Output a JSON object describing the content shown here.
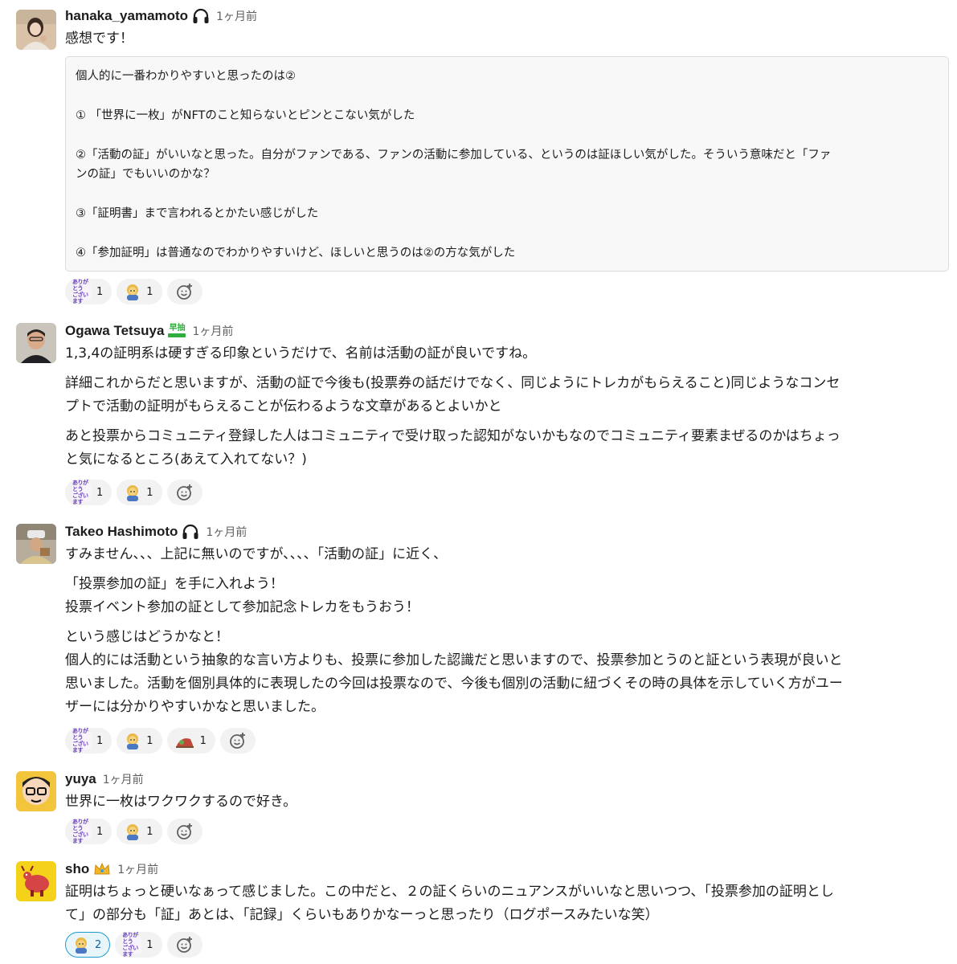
{
  "messages": [
    {
      "user": "hanaka_yamamoto",
      "status_icon": "headphones-icon",
      "time": "1ヶ月前",
      "lines": [
        "感想です！"
      ],
      "code_lines": [
        "個人的に一番わかりやすいと思ったのは②",
        "",
        "①  「世界に一枚」がNFTのこと知らないとピンとこない気がした",
        "",
        "②「活動の証」がいいなと思った。自分がファンである、ファンの活動に参加している、というのは証ほしい気がした。そういう意味だと「ファ",
        "ンの証」でもいいのかな？",
        "",
        "③「証明書」まで言われるとかたい感じがした",
        "",
        "④「参加証明」は普通なのでわかりやすいけど、ほしいと思うのは②の方な気がした"
      ],
      "reactions": [
        {
          "emoji": "arigatou-gozaimasu-icon",
          "count": "1"
        },
        {
          "emoji": "person-bowing-icon",
          "count": "1"
        }
      ]
    },
    {
      "user": "Ogawa Tetsuya",
      "status_icon": "hayaben-icon",
      "status_label": "早抽",
      "time": "1ヶ月前",
      "paragraphs": [
        [
          "1,3,4の証明系は硬すぎる印象というだけで、名前は活動の証が良いですね。"
        ],
        [
          "詳細これからだと思いますが、活動の証で今後も(投票券の話だけでなく、同じようにトレカがもらえること)同じようなコンセ",
          "プトで活動の証明がもらえることが伝わるような文章があるとよいかと"
        ],
        [
          "あと投票からコミュニティ登録した人はコミュニティで受け取った認知がないかもなのでコミュニティ要素まぜるのかはちょっ",
          "と気になるところ(あえて入れてない？)"
        ]
      ],
      "reactions": [
        {
          "emoji": "arigatou-gozaimasu-icon",
          "count": "1"
        },
        {
          "emoji": "person-bowing-icon",
          "count": "1"
        }
      ]
    },
    {
      "user": "Takeo Hashimoto",
      "status_icon": "headphones-icon",
      "time": "1ヶ月前",
      "paragraphs": [
        [
          "すみません、、、上記に無いのですが、、、、「活動の証」に近く、"
        ],
        [
          "「投票参加の証」を手に入れよう！",
          "投票イベント参加の証として参加記念トレカをもうおう！"
        ],
        [
          "という感じはどうかなと！",
          "個人的には活動という抽象的な言い方よりも、投票に参加した認識だと思いますので、投票参加とうのと証という表現が良いと",
          "思いました。活動を個別具体的に表現したの今回は投票なので、今後も個別の活動に紐づくその時の具体を示していく方がユー",
          "ザーには分かりやすいかなと思いました。"
        ]
      ],
      "reactions": [
        {
          "emoji": "arigatou-gozaimasu-icon",
          "count": "1"
        },
        {
          "emoji": "person-bowing-icon",
          "count": "1"
        },
        {
          "emoji": "sliding-person-icon",
          "count": "1"
        }
      ]
    },
    {
      "user": "yuya",
      "time": "1ヶ月前",
      "paragraphs": [
        [
          "世界に一枚はワクワクするので好き。"
        ]
      ],
      "reactions": [
        {
          "emoji": "arigatou-gozaimasu-icon",
          "count": "1"
        },
        {
          "emoji": "person-bowing-icon",
          "count": "1"
        }
      ]
    },
    {
      "user": "sho",
      "status_icon": "crown-icon",
      "time": "1ヶ月前",
      "paragraphs": [
        [
          "証明はちょっと硬いなぁって感じました。この中だと、２の証くらいのニュアンスがいいなと思いつつ、「投票参加の証明とし",
          "て」の部分も「証」あとは、「記録」くらいもありかなーっと思ったり（ログポースみたいな笑）"
        ]
      ],
      "reactions": [
        {
          "emoji": "person-bowing-icon",
          "count": "2",
          "active": true
        },
        {
          "emoji": "arigatou-gozaimasu-icon",
          "count": "1"
        }
      ]
    }
  ],
  "emoji_text": {
    "arigatou_line1": "ありがとう",
    "arigatou_line2": "ございます"
  },
  "colors": {
    "link_blue": "#1264a3",
    "active_reaction_border": "#1d9bd1",
    "reaction_bg": "#f2f2f2",
    "code_bg": "#f8f8f8"
  }
}
